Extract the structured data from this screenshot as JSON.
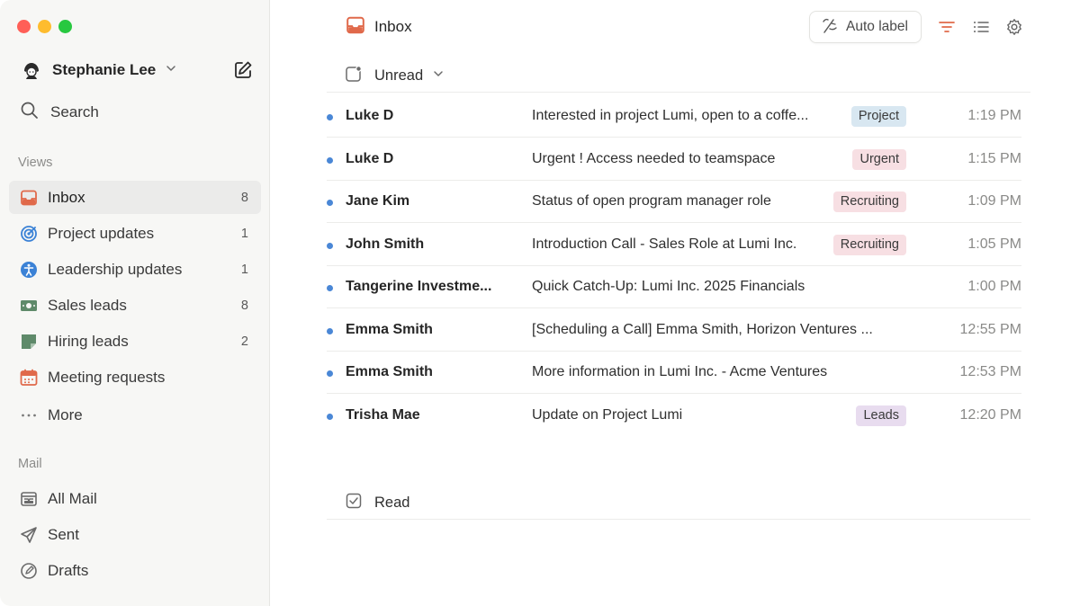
{
  "sidebar": {
    "account_name": "Stephanie Lee",
    "search_label": "Search",
    "views_label": "Views",
    "views": [
      {
        "label": "Inbox",
        "count": "8",
        "icon": "inbox-icon",
        "color": "#e0694a"
      },
      {
        "label": "Project updates",
        "count": "1",
        "icon": "target-icon",
        "color": "#3b82d6"
      },
      {
        "label": "Leadership updates",
        "count": "1",
        "icon": "accessibility-icon",
        "color": "#3b82d6"
      },
      {
        "label": "Sales leads",
        "count": "8",
        "icon": "money-icon",
        "color": "#5f8a6a"
      },
      {
        "label": "Hiring leads",
        "count": "2",
        "icon": "note-icon",
        "color": "#5f8a6a"
      },
      {
        "label": "Meeting requests",
        "count": "",
        "icon": "calendar-icon",
        "color": "#e0694a"
      },
      {
        "label": "More",
        "count": "",
        "icon": "more-icon",
        "color": "#7a7a7a"
      }
    ],
    "mail_label": "Mail",
    "mail": [
      {
        "label": "All Mail",
        "icon": "all-mail-icon"
      },
      {
        "label": "Sent",
        "icon": "send-icon"
      },
      {
        "label": "Drafts",
        "icon": "drafts-icon"
      }
    ]
  },
  "header": {
    "title": "Inbox",
    "auto_label": "Auto label",
    "accent_color": "#e0694a"
  },
  "groups": {
    "unread_label": "Unread",
    "read_label": "Read"
  },
  "emails": [
    {
      "sender": "Luke D",
      "subject": "Interested in project Lumi, open to a coffe...",
      "tag": "Project",
      "tag_class": "tag-project",
      "time": "1:19 PM"
    },
    {
      "sender": "Luke D",
      "subject": "Urgent ! Access needed to teamspace",
      "tag": "Urgent",
      "tag_class": "tag-urgent",
      "time": "1:15 PM"
    },
    {
      "sender": "Jane Kim",
      "subject": "Status of open program manager role",
      "tag": "Recruiting",
      "tag_class": "tag-recruiting",
      "time": "1:09 PM"
    },
    {
      "sender": "John Smith",
      "subject": "Introduction Call - Sales Role at Lumi Inc.",
      "tag": "Recruiting",
      "tag_class": "tag-recruiting",
      "time": "1:05 PM"
    },
    {
      "sender": "Tangerine Investme...",
      "subject": "Quick Catch-Up: Lumi Inc. 2025 Financials",
      "tag": "",
      "tag_class": "",
      "time": "1:00 PM"
    },
    {
      "sender": "Emma Smith",
      "subject": "[Scheduling a Call] Emma Smith, Horizon Ventures ...",
      "tag": "",
      "tag_class": "",
      "time": "12:55 PM"
    },
    {
      "sender": "Emma Smith",
      "subject": "More information in Lumi Inc. - Acme Ventures",
      "tag": "",
      "tag_class": "",
      "time": "12:53 PM"
    },
    {
      "sender": "Trisha Mae",
      "subject": "Update on Project Lumi",
      "tag": "Leads",
      "tag_class": "tag-leads",
      "time": "12:20 PM"
    }
  ]
}
